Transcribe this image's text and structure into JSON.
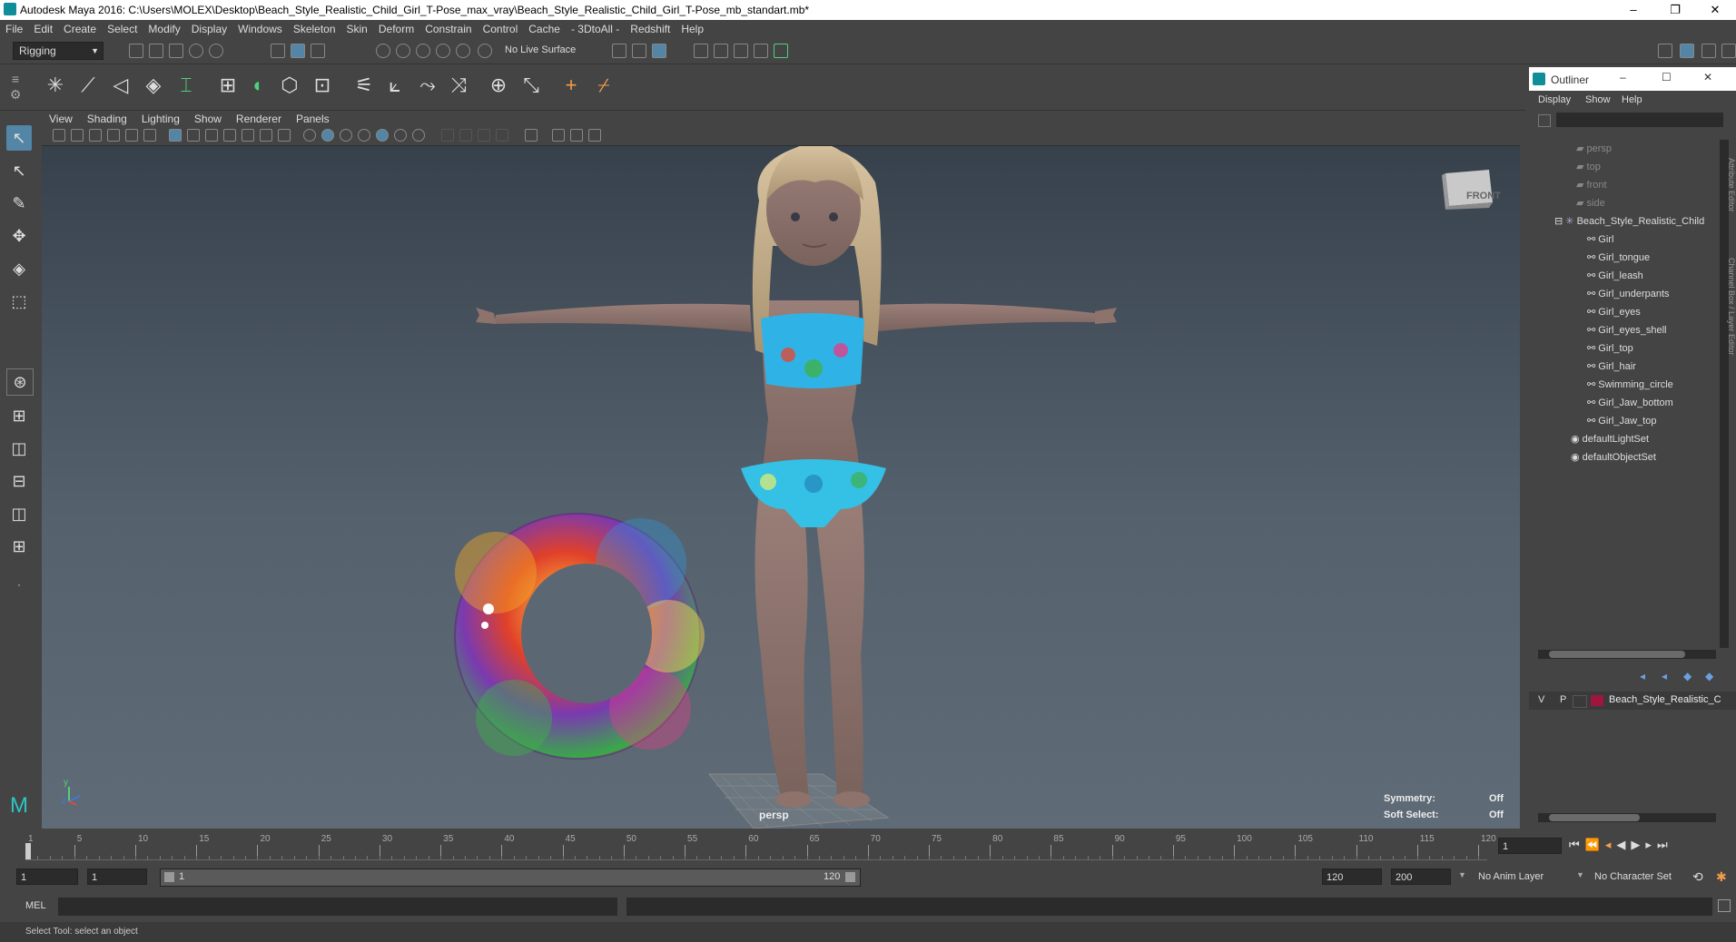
{
  "window": {
    "title": "Autodesk Maya 2016: C:\\Users\\MOLEX\\Desktop\\Beach_Style_Realistic_Child_Girl_T-Pose_max_vray\\Beach_Style_Realistic_Child_Girl_T-Pose_mb_standart.mb*",
    "minimize": "–",
    "restore": "❐",
    "close": "✕"
  },
  "menubar": [
    "File",
    "Edit",
    "Create",
    "Select",
    "Modify",
    "Display",
    "Windows",
    "Skeleton",
    "Skin",
    "Deform",
    "Constrain",
    "Control",
    "Cache",
    "- 3DtoAll -",
    "Redshift",
    "Help"
  ],
  "statusline": {
    "menu_set": "Rigging",
    "live_surface": "No Live Surface"
  },
  "viewport": {
    "menu": [
      "View",
      "Shading",
      "Lighting",
      "Show",
      "Renderer",
      "Panels"
    ],
    "camera_label": "persp",
    "viewcube_label": "FRONT",
    "hud": {
      "symmetry_label": "Symmetry:",
      "symmetry_value": "Off",
      "soft_select_label": "Soft Select:",
      "soft_select_value": "Off"
    },
    "axis_y": "y",
    "axis_z": "z"
  },
  "outliner": {
    "title": "Outliner",
    "menu": [
      "Display",
      "Show",
      "Help"
    ],
    "cameras": [
      "persp",
      "top",
      "front",
      "side"
    ],
    "root": "Beach_Style_Realistic_Child",
    "children": [
      "Girl",
      "Girl_tongue",
      "Girl_leash",
      "Girl_underpants",
      "Girl_eyes",
      "Girl_eyes_shell",
      "Girl_top",
      "Girl_hair",
      "Swimming_circle",
      "Girl_Jaw_bottom",
      "Girl_Jaw_top"
    ],
    "sets": [
      "defaultLightSet",
      "defaultObjectSet"
    ],
    "side_tab_1": "Attribute Editor",
    "side_tab_2": "Channel Box / Layer Editor"
  },
  "layer_editor": {
    "v": "V",
    "p": "P",
    "layer_name": "Beach_Style_Realistic_C",
    "layer_color": "#a0153e"
  },
  "timeline": {
    "ticks": [
      "1",
      "5",
      "10",
      "15",
      "20",
      "25",
      "30",
      "35",
      "40",
      "45",
      "50",
      "55",
      "60",
      "65",
      "70",
      "75",
      "80",
      "85",
      "90",
      "95",
      "100",
      "105",
      "110",
      "115",
      "120"
    ],
    "current_frame": "1"
  },
  "range": {
    "start": "1",
    "playback_start": "1",
    "slider_start": "1",
    "slider_end": "120",
    "playback_end": "120",
    "end": "200",
    "anim_layer": "No Anim Layer",
    "character_set": "No Character Set"
  },
  "command_line": {
    "lang": "MEL"
  },
  "help_line": "Select Tool: select an object"
}
